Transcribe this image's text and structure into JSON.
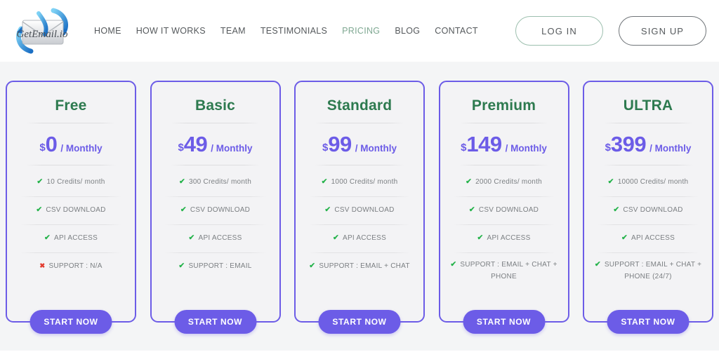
{
  "brand": {
    "logo_text": "GetEmail.io",
    "logo_icon": "envelope-arrows-logo"
  },
  "nav": {
    "links": [
      {
        "label": "HOME",
        "active": false
      },
      {
        "label": "HOW IT WORKS",
        "active": false
      },
      {
        "label": "TEAM",
        "active": false
      },
      {
        "label": "TESTIMONIALS",
        "active": false
      },
      {
        "label": "PRICING",
        "active": true
      },
      {
        "label": "BLOG",
        "active": false
      },
      {
        "label": "CONTACT",
        "active": false
      }
    ],
    "login_label": "LOG IN",
    "signup_label": "SIGN UP"
  },
  "colors": {
    "card_border": "#6c5ce7",
    "price": "#6c5ce7",
    "plan_name": "#2d7a4f",
    "check": "#25b34b",
    "cross": "#e23b2e",
    "active_nav": "#7fa892",
    "section_bg": "#f4f5f6",
    "button_bg": "#6c5ce7"
  },
  "pricing": {
    "cta_label": "START NOW",
    "period_label": "/ Monthly",
    "currency": "$",
    "plans": [
      {
        "name": "Free",
        "amount": "0",
        "features": [
          {
            "icon": "check-icon",
            "included": true,
            "text": "10 Credits/ month"
          },
          {
            "icon": "check-icon",
            "included": true,
            "text": "CSV DOWNLOAD"
          },
          {
            "icon": "check-icon",
            "included": true,
            "text": "API ACCESS"
          },
          {
            "icon": "cross-icon",
            "included": false,
            "text": "SUPPORT : N/A"
          }
        ]
      },
      {
        "name": "Basic",
        "amount": "49",
        "features": [
          {
            "icon": "check-icon",
            "included": true,
            "text": "300 Credits/ month"
          },
          {
            "icon": "check-icon",
            "included": true,
            "text": "CSV DOWNLOAD"
          },
          {
            "icon": "check-icon",
            "included": true,
            "text": "API ACCESS"
          },
          {
            "icon": "check-icon",
            "included": true,
            "text": "SUPPORT : EMAIL"
          }
        ]
      },
      {
        "name": "Standard",
        "amount": "99",
        "features": [
          {
            "icon": "check-icon",
            "included": true,
            "text": "1000 Credits/ month"
          },
          {
            "icon": "check-icon",
            "included": true,
            "text": "CSV DOWNLOAD"
          },
          {
            "icon": "check-icon",
            "included": true,
            "text": "API ACCESS"
          },
          {
            "icon": "check-icon",
            "included": true,
            "text": "SUPPORT : EMAIL + CHAT"
          }
        ]
      },
      {
        "name": "Premium",
        "amount": "149",
        "features": [
          {
            "icon": "check-icon",
            "included": true,
            "text": "2000 Credits/ month"
          },
          {
            "icon": "check-icon",
            "included": true,
            "text": "CSV DOWNLOAD"
          },
          {
            "icon": "check-icon",
            "included": true,
            "text": "API ACCESS"
          },
          {
            "icon": "check-icon",
            "included": true,
            "text": "SUPPORT : EMAIL + CHAT + PHONE"
          }
        ]
      },
      {
        "name": "ULTRA",
        "amount": "399",
        "features": [
          {
            "icon": "check-icon",
            "included": true,
            "text": "10000 Credits/ month"
          },
          {
            "icon": "check-icon",
            "included": true,
            "text": "CSV DOWNLOAD"
          },
          {
            "icon": "check-icon",
            "included": true,
            "text": "API ACCESS"
          },
          {
            "icon": "check-icon",
            "included": true,
            "text": "SUPPORT : EMAIL + CHAT + PHONE (24/7)"
          }
        ]
      }
    ]
  },
  "glyphs": {
    "check": "✔",
    "cross": "✖"
  }
}
